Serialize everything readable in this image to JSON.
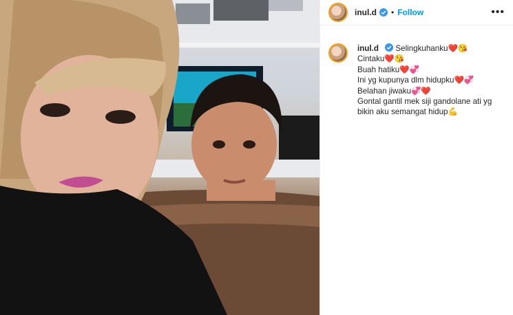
{
  "post": {
    "username": "inul.d",
    "follow_label": "Follow",
    "separator": "•",
    "more_label": "•••",
    "caption_lines": [
      "Selingkuhanku❤️😘",
      "Cintaku❤️😘",
      "Buah hatiku❤️💞",
      "Ini yg kupunya dlm hidupku❤️💞",
      "Belahan jiwaku💞❤️",
      "Gontal gantil mek siji gandolane ati yg bikin aku semangat hidup💪"
    ]
  },
  "colors": {
    "accent": "#0095f6",
    "verified": "#3897f0",
    "avatar_ring": "#f4a21a"
  },
  "icons": {
    "verified": "verified-badge-icon",
    "more": "more-options-icon"
  }
}
